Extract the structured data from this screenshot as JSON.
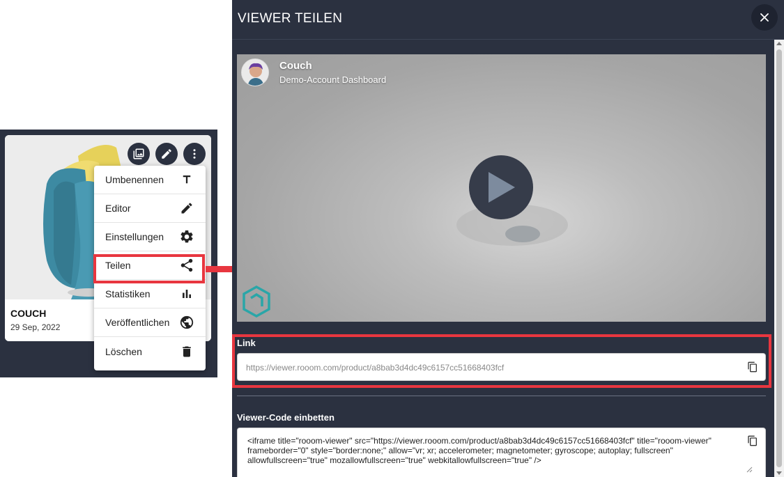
{
  "card": {
    "title": "COUCH",
    "date": "29 Sep, 2022",
    "buttons": [
      "gallery-icon",
      "edit-icon",
      "more-vertical-icon"
    ]
  },
  "menu": {
    "items": [
      {
        "label": "Umbenennen",
        "icon": "text-icon"
      },
      {
        "label": "Editor",
        "icon": "pencil-icon"
      },
      {
        "label": "Einstellungen",
        "icon": "gear-icon"
      },
      {
        "label": "Teilen",
        "icon": "share-icon"
      },
      {
        "label": "Statistiken",
        "icon": "bar-chart-icon"
      },
      {
        "label": "Veröffentlichen",
        "icon": "globe-icon"
      },
      {
        "label": "Löschen",
        "icon": "trash-icon"
      }
    ]
  },
  "dialog": {
    "title": "VIEWER TEILEN",
    "close_icon": "close-icon",
    "viewer": {
      "name": "Couch",
      "subtitle": "Demo-Account Dashboard"
    },
    "link": {
      "label": "Link",
      "value": "https://viewer.rooom.com/product/a8bab3d4dc49c6157cc51668403fcf"
    },
    "embed": {
      "label": "Viewer-Code einbetten",
      "value": "<iframe title=\"rooom-viewer\" src=\"https://viewer.rooom.com/product/a8bab3d4dc49c6157cc51668403fcf\" title=\"rooom-viewer\" frameborder=\"0\" style=\"border:none;\" allow=\"vr; xr; accelerometer; magnetometer; gyroscope; autoplay; fullscreen\" allowfullscreen=\"true\" mozallowfullscreen=\"true\" webkitallowfullscreen=\"true\" />"
    }
  },
  "colors": {
    "panel": "#2b3140",
    "highlight": "#e8363f",
    "logo": "#2aa6a8"
  }
}
